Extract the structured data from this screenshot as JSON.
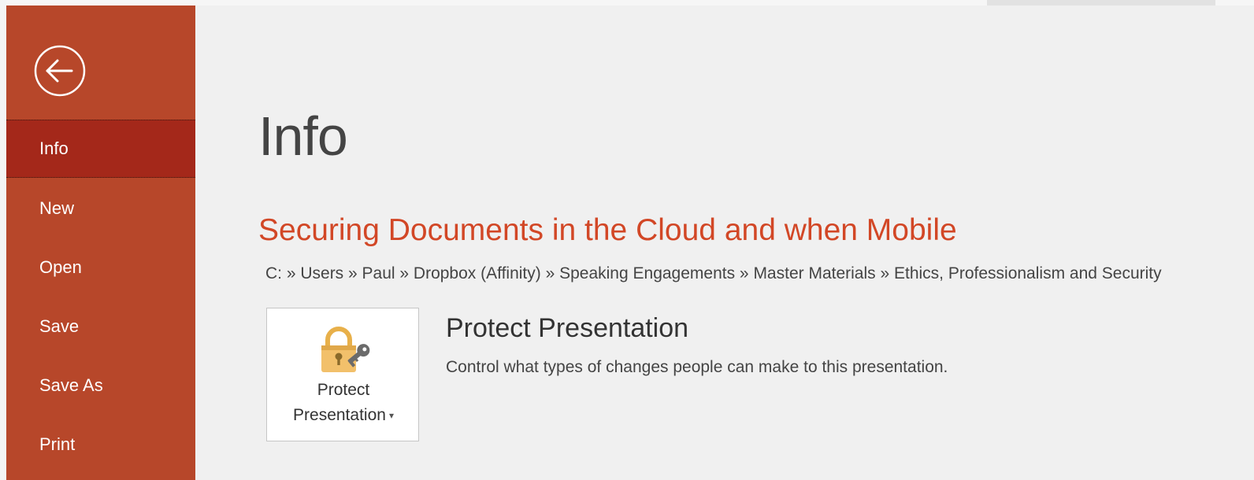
{
  "backstage": {
    "back_label": "Back",
    "nav": [
      {
        "label": "Info",
        "selected": true
      },
      {
        "label": "New",
        "selected": false
      },
      {
        "label": "Open",
        "selected": false
      },
      {
        "label": "Save",
        "selected": false
      },
      {
        "label": "Save As",
        "selected": false
      },
      {
        "label": "Print",
        "selected": false
      }
    ]
  },
  "main": {
    "page_title": "Info",
    "document_title": "Securing Documents in the Cloud and when Mobile",
    "path": "C: » Users » Paul » Dropbox (Affinity) » Speaking Engagements » Master Materials » Ethics, Professionalism and Security",
    "protect": {
      "button_line1": "Protect",
      "button_line2": "Presentation",
      "caret": "▾",
      "title": "Protect Presentation",
      "description": "Control what types of changes people can make to this presentation."
    }
  },
  "colors": {
    "sidebar": "#b7472a",
    "sidebar_selected": "#a4281a",
    "document_title": "#d24726",
    "background": "#f0f0f0"
  },
  "icons": {
    "back": "back-arrow-circle-icon",
    "protect": "lock-key-icon"
  }
}
